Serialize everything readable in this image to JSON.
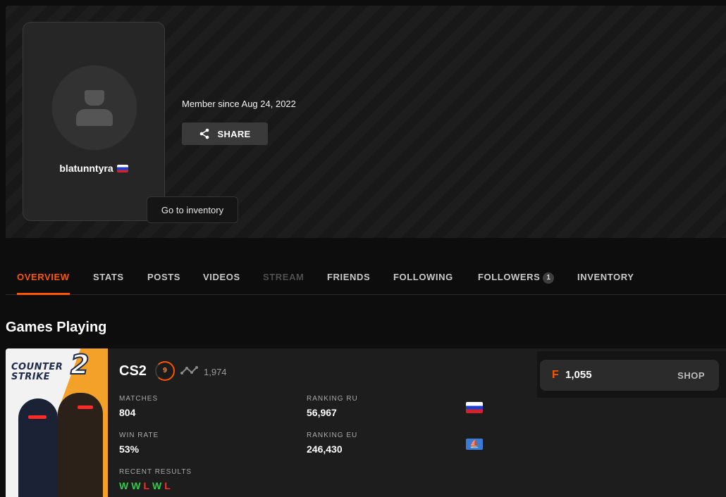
{
  "profile": {
    "username": "blatunntyra",
    "member_since": "Member since Aug 24, 2022",
    "share_label": "SHARE",
    "tooltip": "Go to inventory",
    "country_flag_icon": "flag-ru-icon"
  },
  "tabs": [
    {
      "label": "OVERVIEW",
      "state": "active"
    },
    {
      "label": "STATS",
      "state": "normal"
    },
    {
      "label": "POSTS",
      "state": "normal"
    },
    {
      "label": "VIDEOS",
      "state": "normal"
    },
    {
      "label": "STREAM",
      "state": "disabled"
    },
    {
      "label": "FRIENDS",
      "state": "normal"
    },
    {
      "label": "FOLLOWING",
      "state": "normal"
    },
    {
      "label": "FOLLOWERS",
      "state": "normal",
      "count": "1"
    },
    {
      "label": "INVENTORY",
      "state": "normal"
    }
  ],
  "games": {
    "section_title": "Games Playing",
    "cs2": {
      "cover_line1": "COUNTER",
      "cover_line2": "STRIKE",
      "cover_number": "2",
      "title": "CS2",
      "level": "9",
      "elo": "1,974",
      "matches_label": "MATCHES",
      "matches": "804",
      "win_rate_label": "WIN RATE",
      "win_rate": "53%",
      "ranking_ru_label": "RANKING RU",
      "ranking_ru": "56,967",
      "ranking_eu_label": "RANKING EU",
      "ranking_eu": "246,430",
      "eu_flag_glyph": "⛵",
      "recent_results_label": "RECENT RESULTS",
      "recent_results": [
        "W",
        "W",
        "L",
        "W",
        "L"
      ]
    }
  },
  "wallet": {
    "currency_icon": "F",
    "points": "1,055",
    "shop_label": "SHOP"
  },
  "colors": {
    "accent": "#ff5500",
    "win": "#2fcc4a",
    "loss": "#ff2a2a"
  }
}
